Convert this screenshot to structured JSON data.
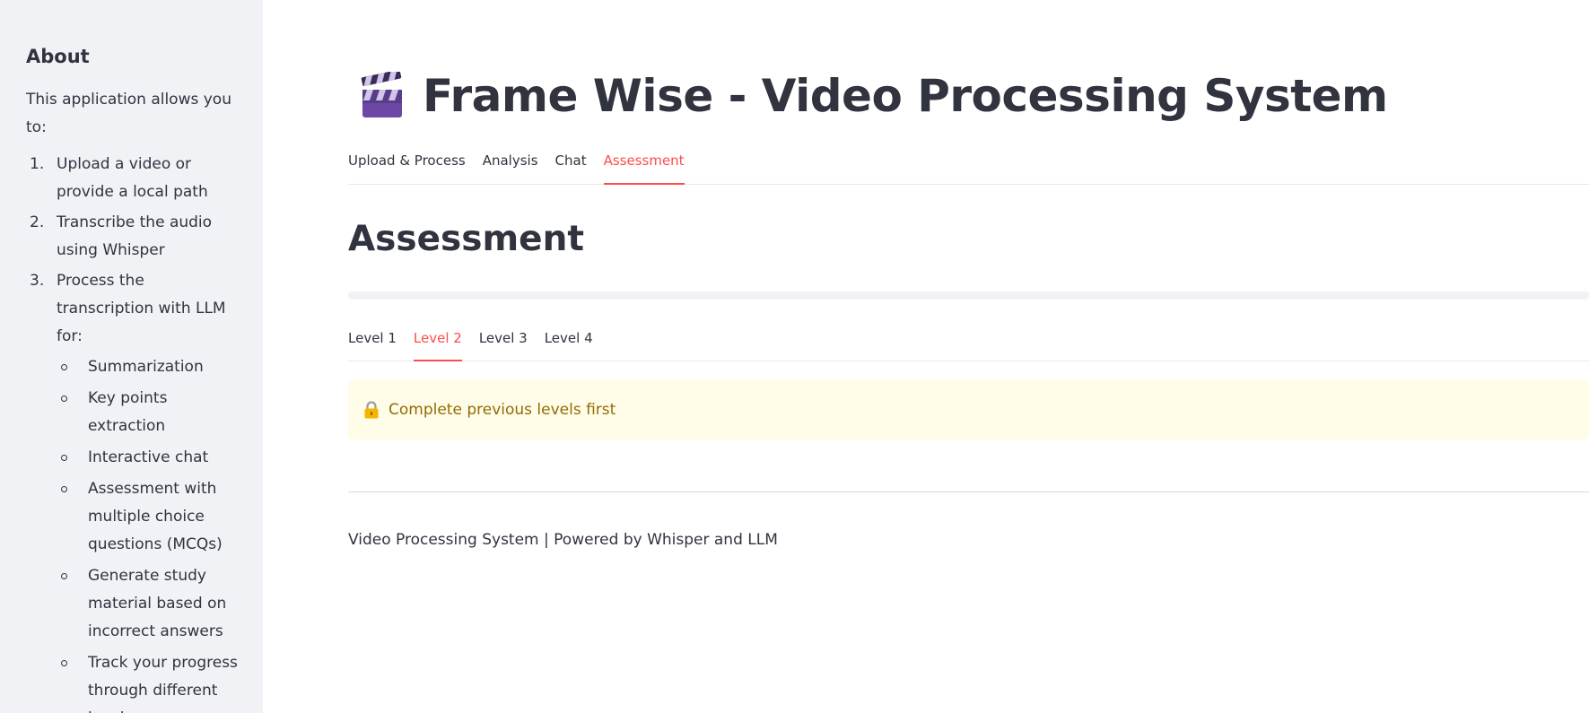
{
  "sidebar": {
    "heading": "About",
    "intro": "This application allows you to:",
    "steps": [
      {
        "num": "1.",
        "text": "Upload a video or provide a local path"
      },
      {
        "num": "2.",
        "text": "Transcribe the audio using Whisper"
      },
      {
        "num": "3.",
        "text": "Process the transcription with LLM for:"
      }
    ],
    "features": [
      "Summarization",
      "Key points extraction",
      "Interactive chat",
      "Assessment with multiple choice questions (MCQs)",
      "Generate study material based on incorrect answers",
      "Track your progress through different levels"
    ]
  },
  "header": {
    "icon": "clapper-board-icon",
    "title": "Frame Wise - Video Processing System"
  },
  "main_tabs": [
    {
      "label": "Upload & Process",
      "active": false
    },
    {
      "label": "Analysis",
      "active": false
    },
    {
      "label": "Chat",
      "active": false
    },
    {
      "label": "Assessment",
      "active": true
    }
  ],
  "section": {
    "title": "Assessment",
    "progress": 0
  },
  "level_tabs": [
    {
      "label": "Level 1",
      "active": false
    },
    {
      "label": "Level 2",
      "active": true
    },
    {
      "label": "Level 3",
      "active": false
    },
    {
      "label": "Level 4",
      "active": false
    }
  ],
  "warning": {
    "icon": "lock-icon",
    "text": "Complete previous levels first"
  },
  "footer": {
    "text": "Video Processing System | Powered by Whisper and LLM"
  },
  "colors": {
    "accent": "#ff4b4b",
    "sidebar_bg": "#f0f2f6",
    "warning_bg": "#fffce7",
    "warning_text": "#926c05"
  }
}
